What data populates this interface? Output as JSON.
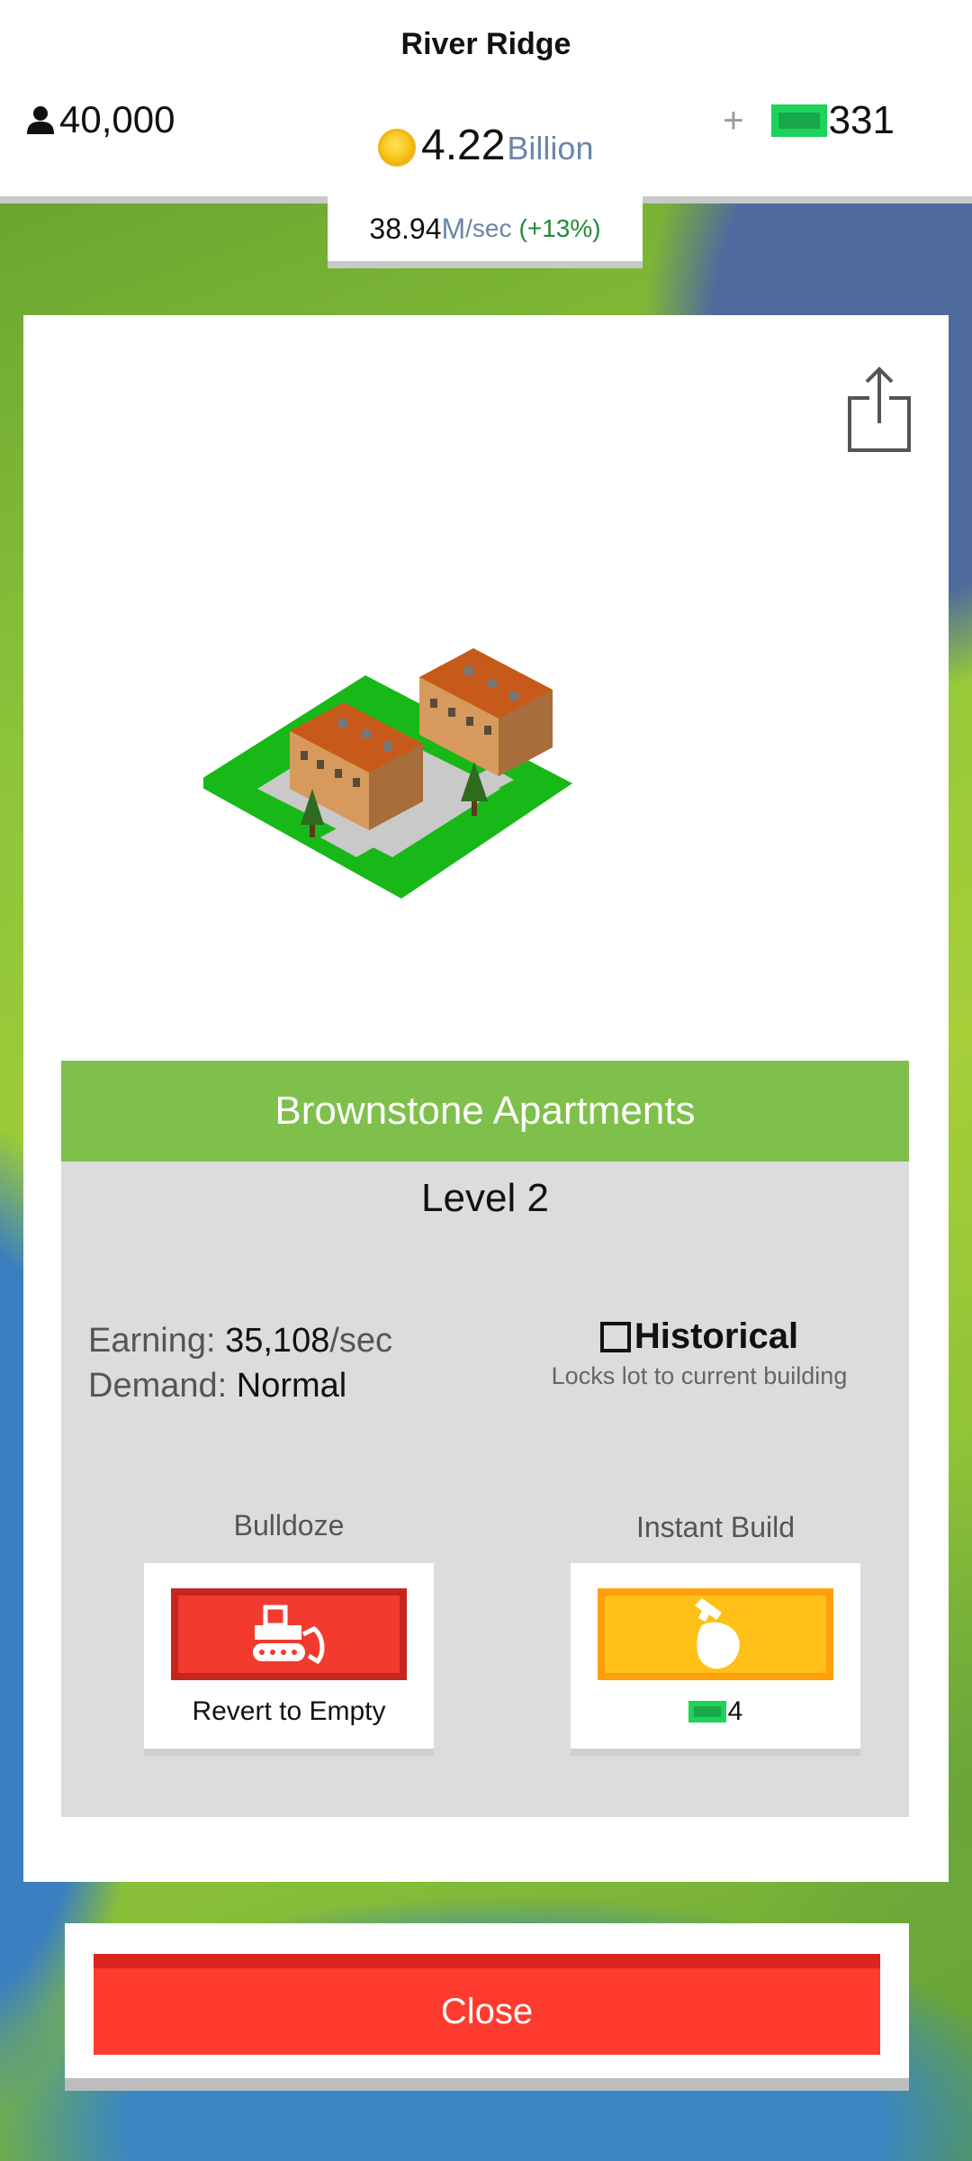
{
  "hud": {
    "city_name": "River Ridge",
    "population": "40,000",
    "coins_value": "4.22",
    "coins_unit": "Billion",
    "cash_plus": "+",
    "cash_value": "331",
    "rate_value": "38.94",
    "rate_unit": "M",
    "rate_suffix": "/sec",
    "rate_change": "(+13%)"
  },
  "building": {
    "name": "Brownstone Apartments",
    "level": "Level 2",
    "earning_label": "Earning:",
    "earning_value": "35,108",
    "earning_suffix": "/sec",
    "demand_label": "Demand:",
    "demand_value": "Normal",
    "historical_label": "Historical",
    "historical_checked": false,
    "historical_hint": "Locks lot to current building"
  },
  "actions": {
    "bulldoze_label": "Bulldoze",
    "bulldoze_caption": "Revert to Empty",
    "instant_label": "Instant Build",
    "instant_cost": "4"
  },
  "footer": {
    "close_label": "Close"
  },
  "icons": {
    "population": "person-icon",
    "coins": "coin-icon",
    "cash": "bill-icon",
    "share": "share-icon",
    "bulldoze": "bulldozer-icon",
    "instant": "hammer-hand-icon"
  },
  "colors": {
    "name_bar": "#7fbf4b",
    "bulldoze_button": "#f23a2e",
    "instant_button": "#ffc118",
    "close_button": "#ff3b2f",
    "cash_green": "#1dd35a"
  }
}
